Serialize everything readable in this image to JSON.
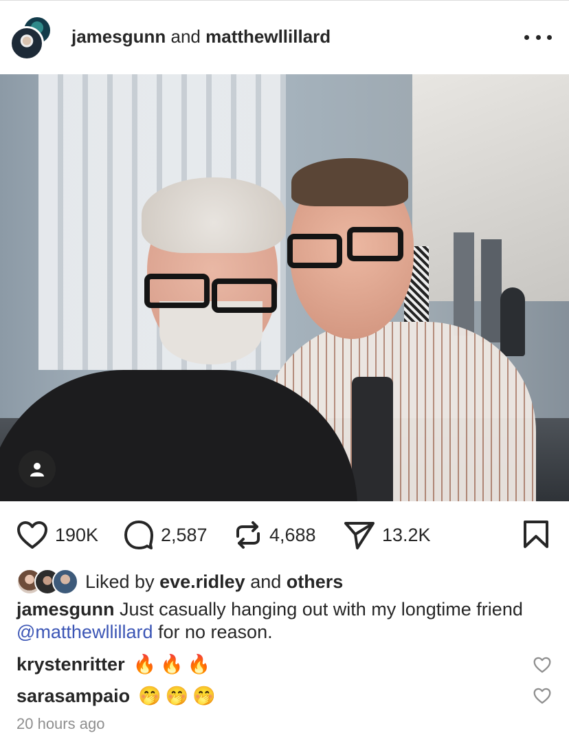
{
  "header": {
    "user1": "jamesgunn",
    "joiner": "and",
    "user2": "matthewllillard",
    "more_icon": "ellipsis-icon"
  },
  "post": {
    "actions": {
      "likes": "190K",
      "comments": "2,587",
      "reposts": "4,688",
      "shares": "13.2K"
    },
    "liked_by": {
      "prefix": "Liked by",
      "user": "eve.ridley",
      "joiner": "and",
      "others": "others"
    },
    "caption": {
      "user": "jamesgunn",
      "text_before": "Just casually hanging out with my longtime friend",
      "mention": "@matthewllillard",
      "text_after": "for no reason."
    },
    "comments": [
      {
        "user": "krystenritter",
        "text": "🔥🔥🔥"
      },
      {
        "user": "sarasampaio",
        "text": "🤭🤭🤭"
      }
    ],
    "timestamp": "20 hours ago"
  }
}
